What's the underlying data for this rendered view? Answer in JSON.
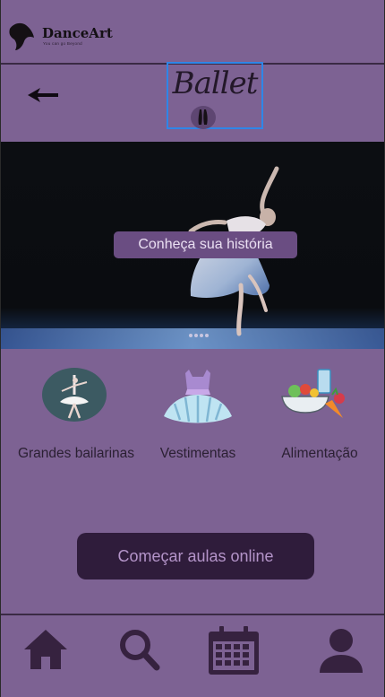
{
  "header": {
    "brand_name": "DanceArt",
    "brand_tagline": "You can go Beyond"
  },
  "title_bar": {
    "title": "Ballet",
    "back_icon": "arrow-left-icon",
    "badge_icon": "pointe-shoes-icon"
  },
  "hero": {
    "cta_label": "Conheça sua história",
    "dots": 4
  },
  "categories": [
    {
      "label": "Grandes bailarinas",
      "icon": "ballerina-icon"
    },
    {
      "label": "Vestimentas",
      "icon": "tutu-dress-icon"
    },
    {
      "label": "Alimentação",
      "icon": "food-icon"
    }
  ],
  "primary_action": {
    "label": "Começar aulas online"
  },
  "bottom_nav": [
    {
      "name": "home",
      "icon": "home-icon"
    },
    {
      "name": "search",
      "icon": "search-icon"
    },
    {
      "name": "calendar",
      "icon": "calendar-icon"
    },
    {
      "name": "profile",
      "icon": "user-icon"
    }
  ],
  "colors": {
    "background": "#7d6293",
    "accent_dark": "#2f1c3b",
    "highlight_border": "#2f86e8",
    "hero_button": "#6a4d82"
  }
}
